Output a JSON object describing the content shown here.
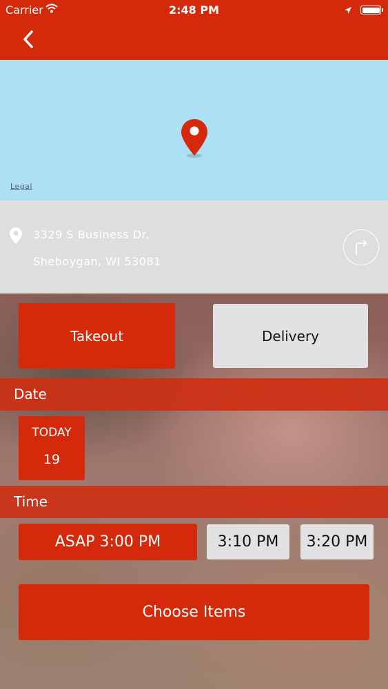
{
  "status_bar": {
    "carrier": "Carrier",
    "time": "2:48 PM"
  },
  "map": {
    "legal_label": "Legal"
  },
  "address": {
    "line1": "3329 S Business Dr.",
    "line2": "Sheboygan, WI 53081"
  },
  "order_type": {
    "takeout_label": "Takeout",
    "delivery_label": "Delivery",
    "selected": "Takeout"
  },
  "date_section": {
    "header": "Date",
    "selected_day_label": "TODAY",
    "selected_day_number": "19"
  },
  "time_section": {
    "header": "Time",
    "slots": [
      "ASAP 3:00 PM",
      "3:10 PM",
      "3:20 PM"
    ],
    "selected": "ASAP 3:00 PM"
  },
  "actions": {
    "choose_items_label": "Choose Items"
  },
  "colors": {
    "brand_red": "#d42a0b",
    "map_water": "#aee0f4",
    "address_panel": "#dedede",
    "unselected_button": "#e2e2e2"
  },
  "icons": [
    "wifi-icon",
    "location-arrow-icon",
    "battery-icon",
    "back-chevron-icon",
    "map-pin-icon",
    "address-pin-icon",
    "directions-icon"
  ]
}
